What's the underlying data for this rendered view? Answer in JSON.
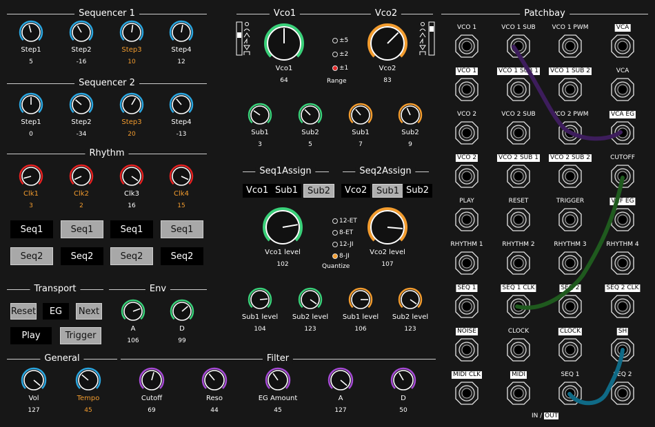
{
  "colors": {
    "blue": "#2aa6e0",
    "green": "#39d079",
    "orange": "#f39c2e",
    "red": "#e62020",
    "purple": "#a64ad6",
    "cable_purple": "#3d1d5c",
    "cable_green": "#1f5a1e",
    "cable_blue": "#0f6a86",
    "label_orange": "#f39c2e"
  },
  "sequencer1": {
    "title": "Sequencer 1",
    "knobs": [
      {
        "label": "Step1",
        "value": "5",
        "angle": -15,
        "active": false
      },
      {
        "label": "Step2",
        "value": "-16",
        "angle": -30,
        "active": false
      },
      {
        "label": "Step3",
        "value": "10",
        "angle": 8,
        "active": true
      },
      {
        "label": "Step4",
        "value": "12",
        "angle": 10,
        "active": false
      }
    ]
  },
  "sequencer2": {
    "title": "Sequencer 2",
    "knobs": [
      {
        "label": "Step1",
        "value": "0",
        "angle": 0,
        "active": false
      },
      {
        "label": "Step2",
        "value": "-34",
        "angle": -50,
        "active": false
      },
      {
        "label": "Step3",
        "value": "20",
        "angle": 30,
        "active": true
      },
      {
        "label": "Step4",
        "value": "-13",
        "angle": -40,
        "active": false
      }
    ]
  },
  "rhythm": {
    "title": "Rhythm",
    "knobs": [
      {
        "label": "Clk1",
        "value": "3",
        "angle": -105,
        "active": true
      },
      {
        "label": "Clk2",
        "value": "2",
        "angle": -115,
        "active": true
      },
      {
        "label": "Clk3",
        "value": "16",
        "angle": 125,
        "active": false
      },
      {
        "label": "Clk4",
        "value": "15",
        "angle": 115,
        "active": true
      }
    ],
    "row1": [
      {
        "label": "Seq1",
        "on": true
      },
      {
        "label": "Seq1",
        "on": false
      },
      {
        "label": "Seq1",
        "on": true
      },
      {
        "label": "Seq1",
        "on": false
      }
    ],
    "row2": [
      {
        "label": "Seq2",
        "on": false
      },
      {
        "label": "Seq2",
        "on": true
      },
      {
        "label": "Seq2",
        "on": false
      },
      {
        "label": "Seq2",
        "on": true
      }
    ]
  },
  "transport": {
    "title": "Transport",
    "reset": "Reset",
    "eg": "EG",
    "next": "Next",
    "play": "Play",
    "trigger": "Trigger"
  },
  "env": {
    "title": "Env",
    "knobs": [
      {
        "label": "A",
        "value": "106"
      },
      {
        "label": "D",
        "value": "99"
      }
    ],
    "angles": [
      70,
      50
    ]
  },
  "general": {
    "title": "General",
    "knobs": [
      {
        "label": "Vol",
        "value": "127",
        "angle": 130,
        "active": false
      },
      {
        "label": "Tempo",
        "value": "45",
        "angle": -50,
        "active": true
      }
    ]
  },
  "filter": {
    "title": "Filter",
    "knobs": [
      {
        "label": "Cutoff",
        "value": "69",
        "angle": 15
      },
      {
        "label": "Reso",
        "value": "44",
        "angle": -40
      },
      {
        "label": "EG Amount",
        "value": "45",
        "angle": -35
      },
      {
        "label": "A",
        "value": "127",
        "angle": 130
      },
      {
        "label": "D",
        "value": "50",
        "angle": -30
      }
    ]
  },
  "vco1": {
    "title": "Vco1",
    "label": "Vco1",
    "value": "64",
    "angle": 0,
    "waves": [
      "○",
      "⌒",
      "/\\",
      "/|",
      "▽",
      "⊓"
    ]
  },
  "vco2": {
    "title": "Vco2",
    "label": "Vco2",
    "value": "83",
    "angle": 45
  },
  "range": {
    "label": "Range",
    "options": [
      {
        "label": "±5",
        "selected": false
      },
      {
        "label": "±2",
        "selected": false
      },
      {
        "label": "±1",
        "selected": true
      }
    ]
  },
  "subs": [
    {
      "label": "Sub1",
      "value": "3",
      "angle": -55,
      "color": "green"
    },
    {
      "label": "Sub2",
      "value": "5",
      "angle": -45,
      "color": "green"
    },
    {
      "label": "Sub1",
      "value": "7",
      "angle": -40,
      "color": "orange"
    },
    {
      "label": "Sub2",
      "value": "9",
      "angle": -25,
      "color": "orange"
    }
  ],
  "seq1assign": {
    "title": "Seq1Assign",
    "options": [
      {
        "label": "Vco1",
        "on": true
      },
      {
        "label": "Sub1",
        "on": true
      },
      {
        "label": "Sub2",
        "on": false
      }
    ]
  },
  "seq2assign": {
    "title": "Seq2Assign",
    "options": [
      {
        "label": "Vco2",
        "on": true
      },
      {
        "label": "Sub1",
        "on": false
      },
      {
        "label": "Sub2",
        "on": true
      }
    ]
  },
  "vco1level": {
    "label": "Vco1 level",
    "value": "102",
    "angle": 80
  },
  "vco2level": {
    "label": "Vco2 level",
    "value": "107",
    "angle": 95
  },
  "quantize": {
    "label": "Quantize",
    "options": [
      {
        "label": "12-ET",
        "selected": false
      },
      {
        "label": "8-ET",
        "selected": false
      },
      {
        "label": "12-JI",
        "selected": false
      },
      {
        "label": "8-JI",
        "selected": true
      }
    ]
  },
  "levels": [
    {
      "label": "Sub1 level",
      "value": "104",
      "angle": 85,
      "color": "green"
    },
    {
      "label": "Sub2 level",
      "value": "123",
      "angle": 125,
      "color": "green"
    },
    {
      "label": "Sub1 level",
      "value": "106",
      "angle": 90,
      "color": "orange"
    },
    {
      "label": "Sub2 level",
      "value": "123",
      "angle": 125,
      "color": "orange"
    }
  ],
  "patchbay": {
    "title": "Patchbay",
    "footer_in": "IN /",
    "footer_out": "OUT",
    "rows": [
      [
        {
          "label": "VCO 1",
          "out": false
        },
        {
          "label": "VCO 1 SUB",
          "out": false
        },
        {
          "label": "VCO 1 PWM",
          "out": false
        },
        {
          "label": "VCA",
          "out": true
        }
      ],
      [
        {
          "label": "VCO 1",
          "out": true
        },
        {
          "label": "VCO 1 SUB 1",
          "out": true
        },
        {
          "label": "VCO 1 SUB 2",
          "out": true
        },
        {
          "label": "VCA",
          "out": false
        }
      ],
      [
        {
          "label": "VCO 2",
          "out": false
        },
        {
          "label": "VCO 2 SUB",
          "out": false
        },
        {
          "label": "VCO 2 PWM",
          "out": false
        },
        {
          "label": "VCA EG",
          "out": true
        }
      ],
      [
        {
          "label": "VCO 2",
          "out": true
        },
        {
          "label": "VCO 2 SUB 1",
          "out": true
        },
        {
          "label": "VCO 2 SUB 2",
          "out": true
        },
        {
          "label": "CUTOFF",
          "out": false
        }
      ],
      [
        {
          "label": "PLAY",
          "out": false
        },
        {
          "label": "RESET",
          "out": false
        },
        {
          "label": "TRIGGER",
          "out": false
        },
        {
          "label": "VCF EG",
          "out": true
        }
      ],
      [
        {
          "label": "RHYTHM 1",
          "out": false
        },
        {
          "label": "RHYTHM 2",
          "out": false
        },
        {
          "label": "RHYTHM 3",
          "out": false
        },
        {
          "label": "RHYTHM 4",
          "out": false
        }
      ],
      [
        {
          "label": "SEQ 1",
          "out": true
        },
        {
          "label": "SEQ 1 CLK",
          "out": true
        },
        {
          "label": "SEQ 2",
          "out": true
        },
        {
          "label": "SEQ 2 CLK",
          "out": true
        }
      ],
      [
        {
          "label": "NOISE",
          "out": true
        },
        {
          "label": "CLOCK",
          "out": false
        },
        {
          "label": "CLOCK",
          "out": true
        },
        {
          "label": "SH",
          "out": true
        }
      ],
      [
        {
          "label": "MIDI CLK",
          "out": true
        },
        {
          "label": "MIDI",
          "out": true
        },
        {
          "label": "SEQ 1",
          "out": false
        },
        {
          "label": "SEQ 2",
          "out": false
        }
      ]
    ]
  }
}
